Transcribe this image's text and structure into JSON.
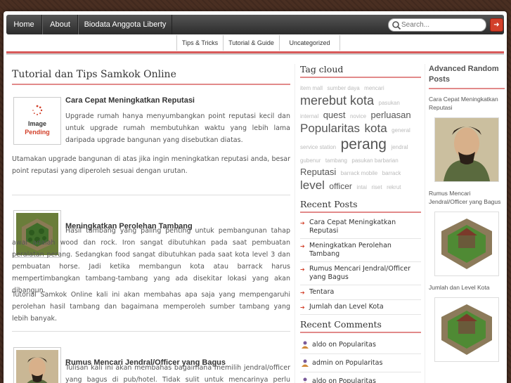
{
  "nav": {
    "items": [
      "Home",
      "About",
      "Biodata Anggota Liberty"
    ],
    "search_placeholder": "Search...",
    "search_button": "➜"
  },
  "subnav": {
    "items": [
      "Tips & Tricks",
      "Tutorial & Guide",
      "Uncategorized"
    ]
  },
  "main": {
    "title": "Tutorial dan Tips Samkok Online",
    "posts": [
      {
        "title": "Cara Cepat Meningkatkan Reputasi",
        "thumb_text_1": "Image",
        "thumb_text_2": "Pending",
        "excerpt": "Upgrade rumah hanya menyumbangkan point reputasi kecil dan untuk upgrade rumah membutuhkan waktu yang lebih lama daripada upgrade bangunan yang disebutkan diatas.",
        "para": "Utamakan upgrade bangunan di atas jika ingin meningkatkan reputasi anda, besar point reputasi yang diperoleh sesuai dengan urutan."
      },
      {
        "title": "Meningkatkan Perolehan Tambang",
        "excerpt": "Hasil tambang yang paling penting untuk pembangunan tahap awal adalah wood dan rock. Iron sangat dibutuhkan pada saat pembuatan peralatan perang. Sedangkan food sangat dibutuhkan pada saat kota level 3 dan pembuatan horse. Jadi ketika membangun kota atau barrack harus mempertimbangkan tambang-tambang yang ada disekitar lokasi yang akan dibangun.",
        "para": "Tutorial Samkok Online kali ini akan membahas apa saja yang mempengaruhi perolehan hasil tambang dan bagaimana memperoleh sumber tambang yang lebih banyak."
      },
      {
        "title": "Rumus Mencari Jendral/Officer yang Bagus",
        "excerpt": "Tulisan kali ini akan membahas bagaimana memilih jendral/officer yang bagus di pub/hotel. Tidak sulit untuk mencarinya perlu menghitung"
      }
    ]
  },
  "tagcloud": {
    "title": "Tag cloud",
    "tags": [
      {
        "t": "item mall",
        "s": 8,
        "big": false
      },
      {
        "t": "sumber daya",
        "s": 8,
        "big": false
      },
      {
        "t": "mencari",
        "s": 8,
        "big": false
      },
      {
        "t": "merebut kota",
        "s": 18,
        "big": true
      },
      {
        "t": "pasukan",
        "s": 8,
        "big": false
      },
      {
        "t": "internal",
        "s": 8,
        "big": false
      },
      {
        "t": "quest",
        "s": 13,
        "big": true
      },
      {
        "t": "novice",
        "s": 8,
        "big": false
      },
      {
        "t": "perluasan",
        "s": 13,
        "big": true
      },
      {
        "t": "Popularitas",
        "s": 17,
        "big": true
      },
      {
        "t": "kota",
        "s": 17,
        "big": true
      },
      {
        "t": "general",
        "s": 8,
        "big": false
      },
      {
        "t": "service station",
        "s": 8,
        "big": false
      },
      {
        "t": "perang",
        "s": 21,
        "big": true
      },
      {
        "t": "jendral",
        "s": 8,
        "big": false
      },
      {
        "t": "gubenur",
        "s": 8,
        "big": false
      },
      {
        "t": "tambang",
        "s": 8,
        "big": false
      },
      {
        "t": "pasukan barbarian",
        "s": 8,
        "big": false
      },
      {
        "t": "Reputasi",
        "s": 13,
        "big": true
      },
      {
        "t": "barrack mobile",
        "s": 8,
        "big": false
      },
      {
        "t": "barrack",
        "s": 8,
        "big": false
      },
      {
        "t": "level",
        "s": 17,
        "big": true
      },
      {
        "t": "officer",
        "s": 12,
        "big": true
      },
      {
        "t": "intai",
        "s": 8,
        "big": false
      },
      {
        "t": "riset",
        "s": 8,
        "big": false
      },
      {
        "t": "rekrut",
        "s": 8,
        "big": false
      }
    ]
  },
  "recent_posts": {
    "title": "Recent Posts",
    "items": [
      "Cara Cepat Meningkatkan Reputasi",
      "Meningkatkan Perolehan Tambang",
      "Rumus Mencari Jendral/Officer yang Bagus",
      "Tentara",
      "Jumlah dan Level Kota"
    ]
  },
  "recent_comments": {
    "title": "Recent Comments",
    "items": [
      "aldo on Popularitas",
      "admin on Popularitas",
      "aldo on Popularitas"
    ]
  },
  "random_posts": {
    "title": "Advanced Random Posts",
    "items": [
      "Cara Cepat Meningkatkan Reputasi",
      "Rumus Mencari Jendral/Officer yang Bagus",
      "Jumlah dan Level Kota"
    ]
  },
  "colors": {
    "accent": "#d2402a",
    "rule": "#e28a8a",
    "nav_bg": "#333333"
  }
}
